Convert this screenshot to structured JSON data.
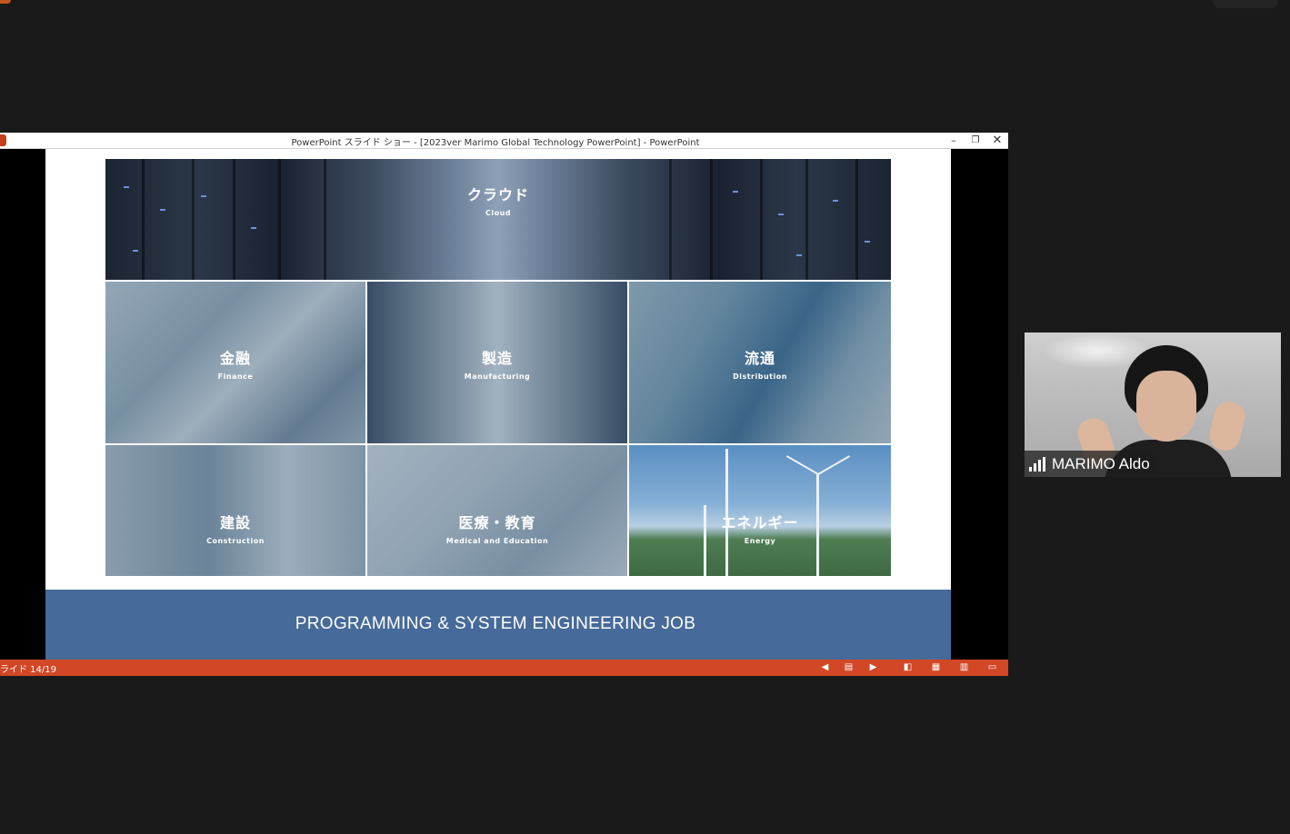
{
  "window": {
    "title": "PowerPoint スライド ショー - [2023ver Marimo Global Technology PowerPoint] - PowerPoint",
    "minimize_glyph": "–",
    "restore_glyph": "❐",
    "close_glyph": "✕"
  },
  "slide": {
    "tiles": [
      {
        "jp": "クラウド",
        "en": "Cloud"
      },
      {
        "jp": "金融",
        "en": "Finance"
      },
      {
        "jp": "製造",
        "en": "Manufacturing"
      },
      {
        "jp": "流通",
        "en": "Distribution"
      },
      {
        "jp": "建設",
        "en": "Construction"
      },
      {
        "jp": "医療・教育",
        "en": "Medical and Education"
      },
      {
        "jp": "エネルギー",
        "en": "Energy"
      }
    ],
    "footer": "PROGRAMMING & SYSTEM ENGINEERING JOB"
  },
  "statusbar": {
    "slide_counter": "ライド 14/19",
    "icons": [
      "previous-icon",
      "slide-list-icon",
      "next-icon",
      "normal-view-icon",
      "slide-sorter-icon",
      "reading-view-icon",
      "slideshow-icon"
    ]
  },
  "participant": {
    "name": "MARIMO Aldo"
  },
  "colors": {
    "background": "#1a1a1a",
    "statusbar": "#d24726",
    "slide_footer": "#466a99"
  }
}
